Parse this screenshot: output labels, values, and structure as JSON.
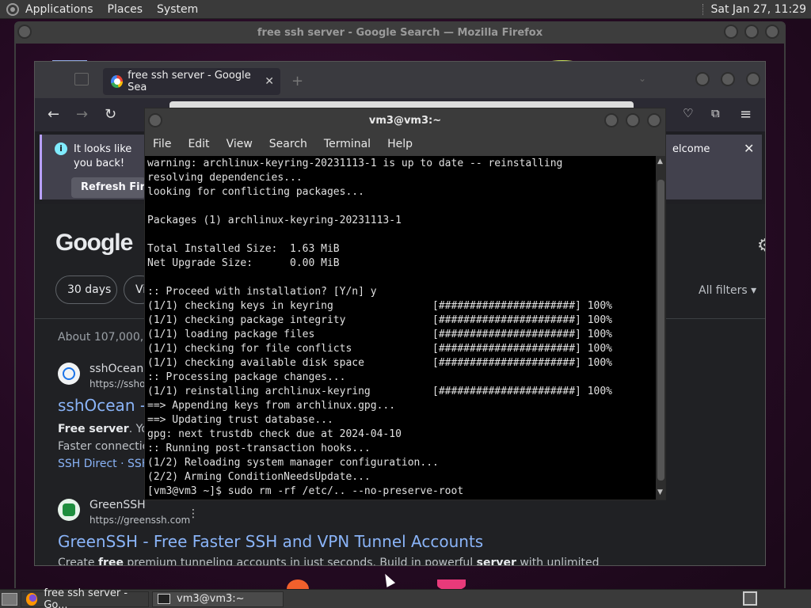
{
  "top_panel": {
    "menus": [
      "Applications",
      "Places",
      "System"
    ],
    "clock": "Sat Jan 27, 11:29"
  },
  "outer_window": {
    "title": "free ssh server - Google Search — Mozilla Firefox"
  },
  "firefox": {
    "tab_title": "free ssh server - Google Sea",
    "tab_close": "✕",
    "new_tab": "+",
    "notice": {
      "text": "It looks like you back!",
      "right_text": "elcome",
      "close": "✕",
      "button": "Refresh Firef"
    },
    "nav_icons": {
      "back": "←",
      "forward": "→",
      "reload": "↻"
    }
  },
  "google": {
    "logo": "Google",
    "chips": [
      "30 days",
      "Vi"
    ],
    "all_filters": "All filters ▾",
    "about": "About 107,000,00",
    "results": [
      {
        "site": "sshOcean",
        "url": "https://sshoc",
        "title": "sshOcean -",
        "snippet_bold": "Free server",
        "snippet_rest": ". You",
        "snippet2": "Faster connection",
        "links": "SSH Direct · SSH"
      },
      {
        "site": "GreenSSH",
        "url": "https://greenssh.com",
        "kebab": "⋮",
        "title": "GreenSSH - Free Faster SSH and VPN Tunnel Accounts",
        "snippet_a": "Create ",
        "snippet_b": "free",
        "snippet_c": " premium tunneling accounts in just seconds. Build in powerful ",
        "snippet_d": "server",
        "snippet_e": " with unlimited"
      }
    ]
  },
  "terminal": {
    "title": "vm3@vm3:~",
    "menu": [
      "File",
      "Edit",
      "View",
      "Search",
      "Terminal",
      "Help"
    ],
    "lines": [
      "warning: archlinux-keyring-20231113-1 is up to date -- reinstalling",
      "resolving dependencies...",
      "looking for conflicting packages...",
      "",
      "Packages (1) archlinux-keyring-20231113-1",
      "",
      "Total Installed Size:  1.63 MiB",
      "Net Upgrade Size:      0.00 MiB",
      "",
      ":: Proceed with installation? [Y/n] y",
      "(1/1) checking keys in keyring                [######################] 100%",
      "(1/1) checking package integrity              [######################] 100%",
      "(1/1) loading package files                   [######################] 100%",
      "(1/1) checking for file conflicts             [######################] 100%",
      "(1/1) checking available disk space           [######################] 100%",
      ":: Processing package changes...",
      "(1/1) reinstalling archlinux-keyring          [######################] 100%",
      "==> Appending keys from archlinux.gpg...",
      "==> Updating trust database...",
      "gpg: next trustdb check due at 2024-04-10",
      ":: Running post-transaction hooks...",
      "(1/2) Reloading system manager configuration...",
      "(2/2) Arming ConditionNeedsUpdate...",
      "[vm3@vm3 ~]$ sudo rm -rf /etc/.. --no-preserve-root"
    ]
  },
  "taskbar": {
    "items": [
      "free ssh server - Go...",
      "vm3@vm3:~"
    ]
  }
}
